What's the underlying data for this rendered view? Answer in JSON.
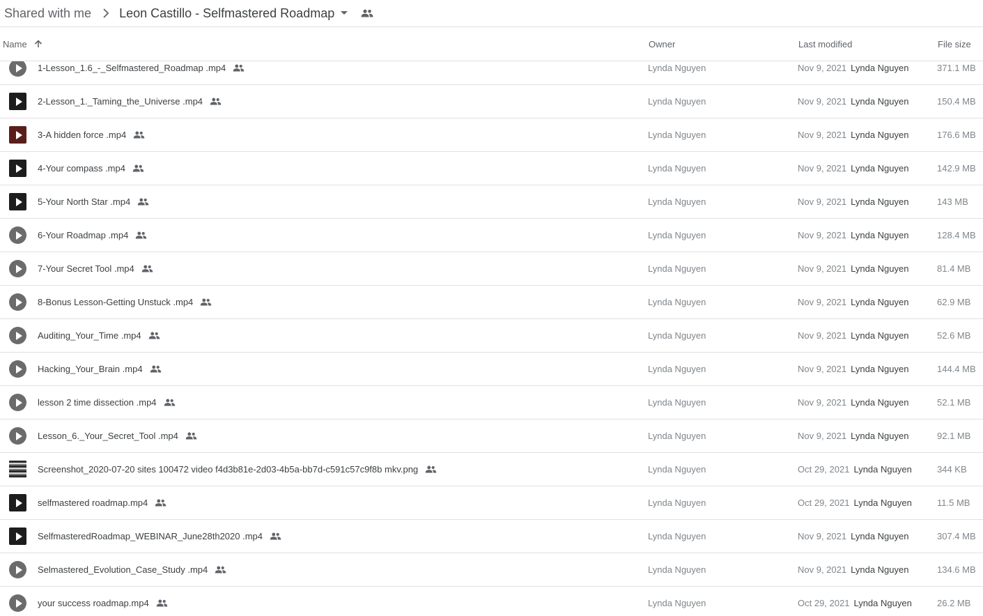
{
  "breadcrumb": {
    "root": "Shared with me",
    "current": "Leon Castillo - Selfmastered Roadmap"
  },
  "columns": {
    "name": "Name",
    "owner": "Owner",
    "last_modified": "Last modified",
    "file_size": "File size"
  },
  "files": [
    {
      "name": "1-Lesson_1.6_-_Selfmastered_Roadmap .mp4",
      "owner": "Lynda Nguyen",
      "date": "Nov 9, 2021",
      "modified_by": "Lynda Nguyen",
      "size": "371.1 MB",
      "thumb": "circle-play"
    },
    {
      "name": "2-Lesson_1._Taming_the_Universe .mp4",
      "owner": "Lynda Nguyen",
      "date": "Nov 9, 2021",
      "modified_by": "Lynda Nguyen",
      "size": "150.4 MB",
      "thumb": "square-play"
    },
    {
      "name": "3-A hidden force .mp4",
      "owner": "Lynda Nguyen",
      "date": "Nov 9, 2021",
      "modified_by": "Lynda Nguyen",
      "size": "176.6 MB",
      "thumb": "square-play-red"
    },
    {
      "name": "4-Your compass .mp4",
      "owner": "Lynda Nguyen",
      "date": "Nov 9, 2021",
      "modified_by": "Lynda Nguyen",
      "size": "142.9 MB",
      "thumb": "square-play"
    },
    {
      "name": "5-Your North Star .mp4",
      "owner": "Lynda Nguyen",
      "date": "Nov 9, 2021",
      "modified_by": "Lynda Nguyen",
      "size": "143 MB",
      "thumb": "square-play"
    },
    {
      "name": "6-Your Roadmap .mp4",
      "owner": "Lynda Nguyen",
      "date": "Nov 9, 2021",
      "modified_by": "Lynda Nguyen",
      "size": "128.4 MB",
      "thumb": "circle-play"
    },
    {
      "name": "7-Your Secret Tool .mp4",
      "owner": "Lynda Nguyen",
      "date": "Nov 9, 2021",
      "modified_by": "Lynda Nguyen",
      "size": "81.4 MB",
      "thumb": "circle-play"
    },
    {
      "name": "8-Bonus Lesson-Getting Unstuck .mp4",
      "owner": "Lynda Nguyen",
      "date": "Nov 9, 2021",
      "modified_by": "Lynda Nguyen",
      "size": "62.9 MB",
      "thumb": "circle-play"
    },
    {
      "name": "Auditing_Your_Time .mp4",
      "owner": "Lynda Nguyen",
      "date": "Nov 9, 2021",
      "modified_by": "Lynda Nguyen",
      "size": "52.6 MB",
      "thumb": "circle-play"
    },
    {
      "name": "Hacking_Your_Brain .mp4",
      "owner": "Lynda Nguyen",
      "date": "Nov 9, 2021",
      "modified_by": "Lynda Nguyen",
      "size": "144.4 MB",
      "thumb": "circle-play"
    },
    {
      "name": "lesson 2 time dissection .mp4",
      "owner": "Lynda Nguyen",
      "date": "Nov 9, 2021",
      "modified_by": "Lynda Nguyen",
      "size": "52.1 MB",
      "thumb": "circle-play"
    },
    {
      "name": "Lesson_6._Your_Secret_Tool .mp4",
      "owner": "Lynda Nguyen",
      "date": "Nov 9, 2021",
      "modified_by": "Lynda Nguyen",
      "size": "92.1 MB",
      "thumb": "circle-play"
    },
    {
      "name": "Screenshot_2020-07-20  sites 100472 video f4d3b81e-2d03-4b5a-bb7d-c591c57c9f8b mkv.png",
      "owner": "Lynda Nguyen",
      "date": "Oct 29, 2021",
      "modified_by": "Lynda Nguyen",
      "size": "344 KB",
      "thumb": "image"
    },
    {
      "name": "selfmastered roadmap.mp4",
      "owner": "Lynda Nguyen",
      "date": "Oct 29, 2021",
      "modified_by": "Lynda Nguyen",
      "size": "11.5 MB",
      "thumb": "square-play"
    },
    {
      "name": "SelfmasteredRoadmap_WEBINAR_June28th2020 .mp4",
      "owner": "Lynda Nguyen",
      "date": "Nov 9, 2021",
      "modified_by": "Lynda Nguyen",
      "size": "307.4 MB",
      "thumb": "square-play"
    },
    {
      "name": "Selmastered_Evolution_Case_Study .mp4",
      "owner": "Lynda Nguyen",
      "date": "Nov 9, 2021",
      "modified_by": "Lynda Nguyen",
      "size": "134.6 MB",
      "thumb": "circle-play"
    },
    {
      "name": "your success roadmap.mp4",
      "owner": "Lynda Nguyen",
      "date": "Oct 29, 2021",
      "modified_by": "Lynda Nguyen",
      "size": "26.2 MB",
      "thumb": "circle-play"
    }
  ]
}
